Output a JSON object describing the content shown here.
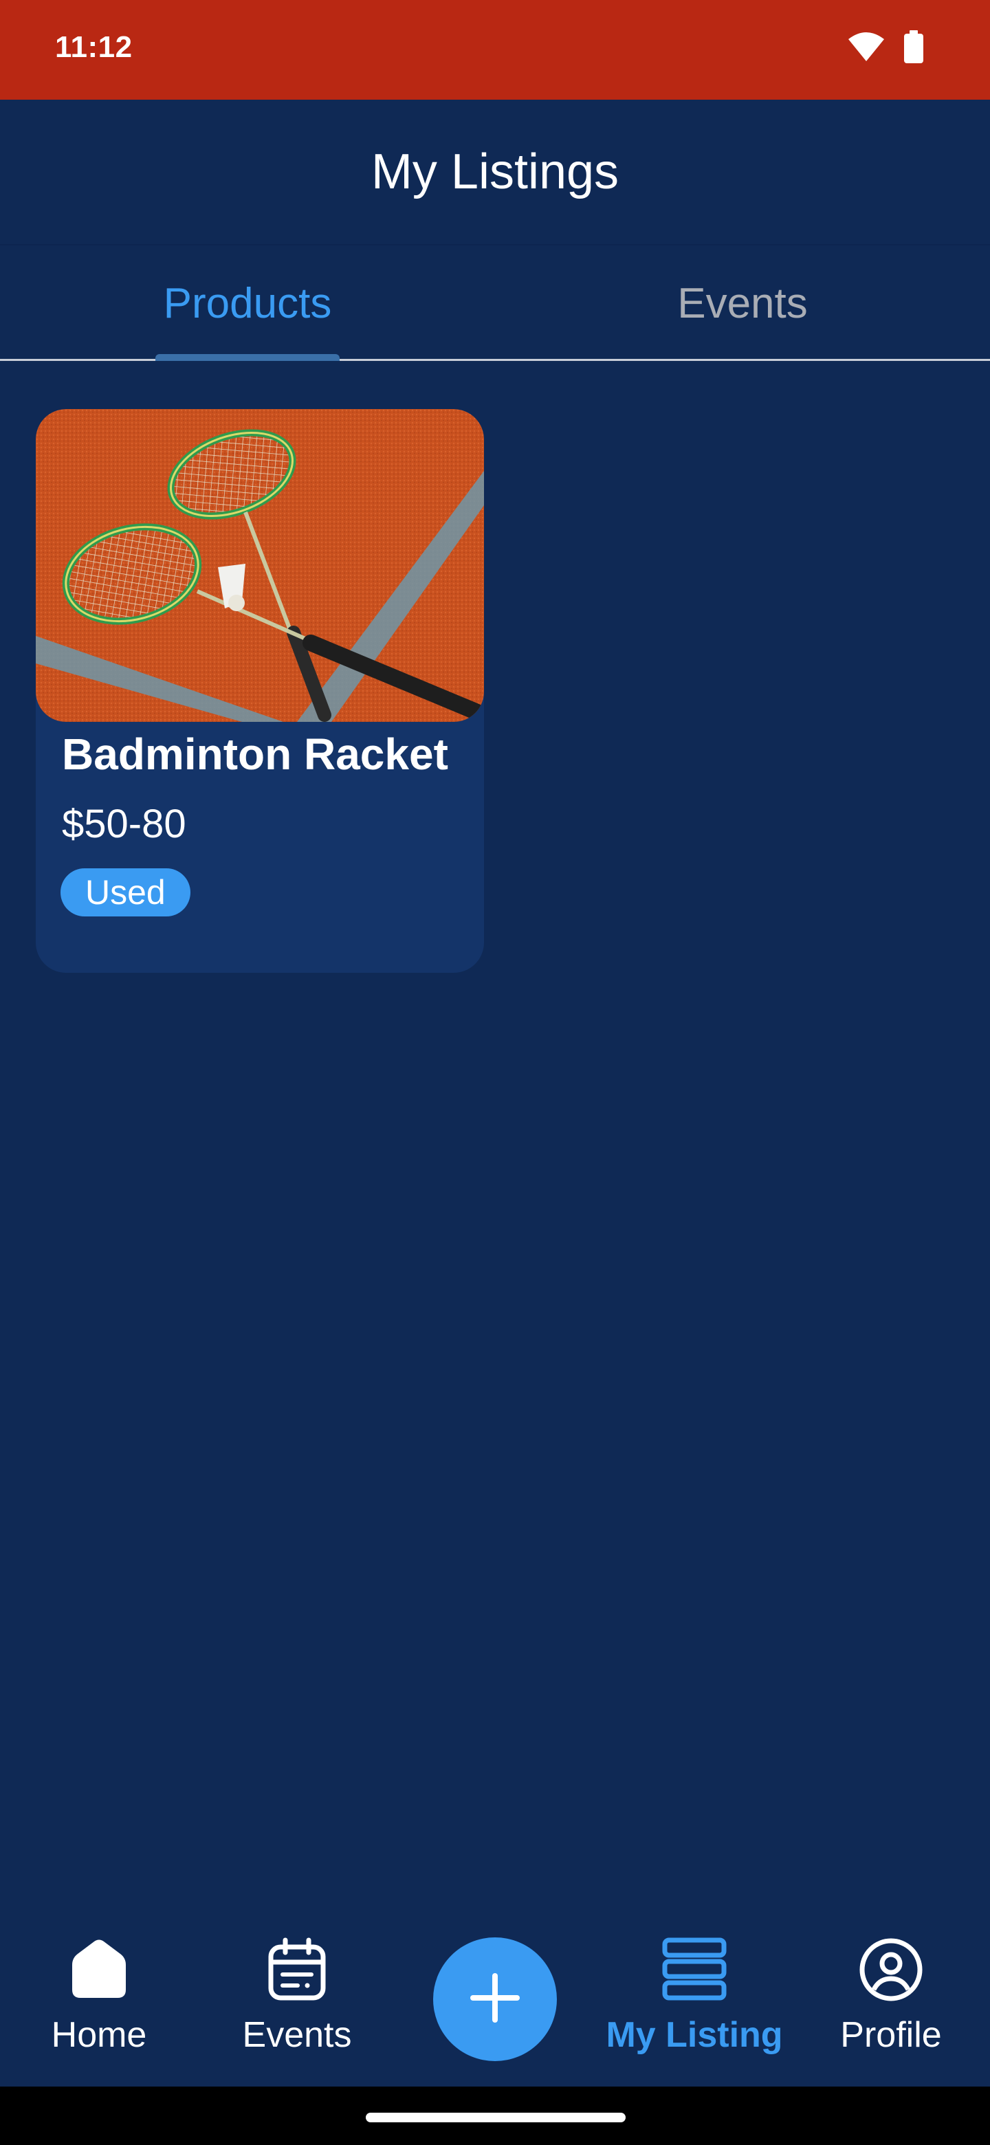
{
  "status_bar": {
    "time": "11:12",
    "icons": [
      "wifi-icon",
      "battery-icon"
    ]
  },
  "header": {
    "title": "My Listings"
  },
  "tabs": [
    {
      "label": "Products",
      "active": true
    },
    {
      "label": "Events",
      "active": false
    }
  ],
  "products": [
    {
      "image": "badminton-racket-photo",
      "title": "Badminton Racket",
      "price": "$50-80",
      "condition": "Used"
    }
  ],
  "bottom_nav": {
    "items": [
      {
        "label": "Home",
        "icon": "home-icon",
        "active": false
      },
      {
        "label": "Events",
        "icon": "calendar-icon",
        "active": false
      },
      {
        "label": "My Listing",
        "icon": "list-icon",
        "active": true
      },
      {
        "label": "Profile",
        "icon": "profile-icon",
        "active": false
      }
    ],
    "fab_icon": "plus-icon"
  },
  "colors": {
    "background": "#0f2955",
    "status_bar": "#b92813",
    "accent": "#3a9bf2",
    "card": "#143469",
    "inactive_tab": "#a9adb5"
  }
}
